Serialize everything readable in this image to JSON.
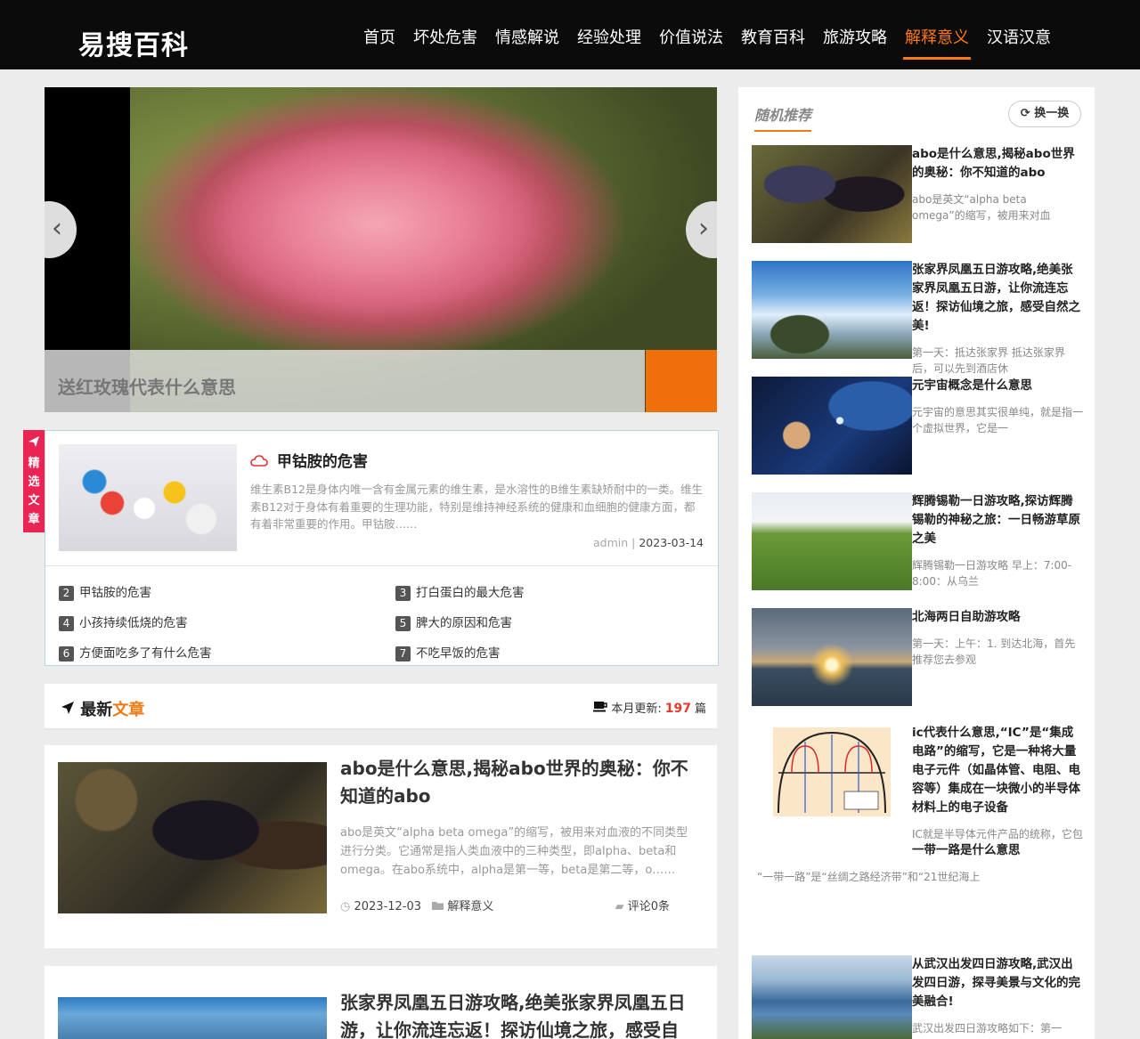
{
  "site": {
    "logo": "易搜百科"
  },
  "nav": {
    "items": [
      {
        "label": "首页"
      },
      {
        "label": "坏处危害"
      },
      {
        "label": "情感解说"
      },
      {
        "label": "经验处理"
      },
      {
        "label": "价值说法"
      },
      {
        "label": "教育百科"
      },
      {
        "label": "旅游攻略"
      },
      {
        "label": "解释意义",
        "active": true
      },
      {
        "label": "汉语汉意"
      }
    ]
  },
  "slider": {
    "caption": "送红玫瑰代表什么意思",
    "prev_icon": "‹",
    "next_icon": "›"
  },
  "featured": {
    "tab_label": "精选文章",
    "title": "甲钴胺的危害",
    "excerpt": "维生素B12是身体内唯一含有金属元素的维生素，是水溶性的B维生素缺矫耐中的一类。维生素B12对于身体有着重要的生理功能，特别是维持神经系统的健康和血细胞的健康方面，都有着非常重要的作用。甲钴胺……",
    "author": "admin",
    "separator": "|",
    "date": "2023-03-14",
    "list": [
      {
        "num": "2",
        "label": "甲钴胺的危害"
      },
      {
        "num": "3",
        "label": "打白蛋白的最大危害"
      },
      {
        "num": "4",
        "label": "小孩持续低烧的危害"
      },
      {
        "num": "5",
        "label": "脾大的原因和危害"
      },
      {
        "num": "6",
        "label": "方便面吃多了有什么危害"
      },
      {
        "num": "7",
        "label": "不吃早饭的危害"
      }
    ]
  },
  "latest": {
    "title_prefix": "最新",
    "title_highlight": "文章",
    "update_label": "本月更新:",
    "update_count": "197",
    "update_unit": "篇",
    "posts": [
      {
        "title": "abo是什么意思,揭秘abo世界的奥秘：你不知道的abo",
        "excerpt": "abo是英文“alpha beta omega”的缩写，被用来对血液的不同类型进行分类。它通常是指人类血液中的三种类型，即alpha、beta和omega。在abo系统中，alpha是第一等，beta是第二等，o……",
        "date": "2023-12-03",
        "category": "解释意义",
        "comments": "评论0条"
      },
      {
        "title": "张家界凤凰五日游攻略,绝美张家界凤凰五日游，让你流连忘返！探访仙境之旅，感受自"
      }
    ]
  },
  "sidebar": {
    "title": "随机推荐",
    "refresh_label": "换一换",
    "items": [
      {
        "title": "abo是什么意思,揭秘abo世界的奥秘：你不知道的abo",
        "desc": "abo是英文“alpha beta omega”的缩写，被用来对血"
      },
      {
        "title": "张家界凤凰五日游攻略,绝美张家界凤凰五日游，让你流连忘返！探访仙境之旅，感受自然之美!",
        "desc": "第一天：抵达张家界 抵达张家界后，可以先到酒店休"
      },
      {
        "title": "元宇宙概念是什么意思",
        "desc": "元宇宙的意思其实很单纯，就是指一个虚拟世界，它是一"
      },
      {
        "title": "辉腾锡勒一日游攻略,探访辉腾锡勒的神秘之旅：一日畅游草原之美",
        "desc": "辉腾锡勒一日游攻略 早上：7:00-8:00：从乌兰"
      },
      {
        "title": "北海两日自助游攻略",
        "desc": "第一天：上午：1. 到达北海，首先推荐您去参观"
      },
      {
        "title": "ic代表什么意思,“IC”是“集成电路”的缩写，它是一种将大量电子元件（如晶体管、电阻、电容等）集成在一块微小的半导体材料上的电子设备",
        "desc": "IC就是半导体元件产品的统称，它包"
      },
      {
        "title": "一带一路是什么意思",
        "desc": "“一带一路”是“丝绸之路经济带”和“21世纪海上"
      },
      {
        "title": "从武汉出发四日游攻略,武汉出发四日游，探寻美景与文化的完美融合!",
        "desc": "武汉出发四日游攻略如下：第一"
      }
    ]
  }
}
